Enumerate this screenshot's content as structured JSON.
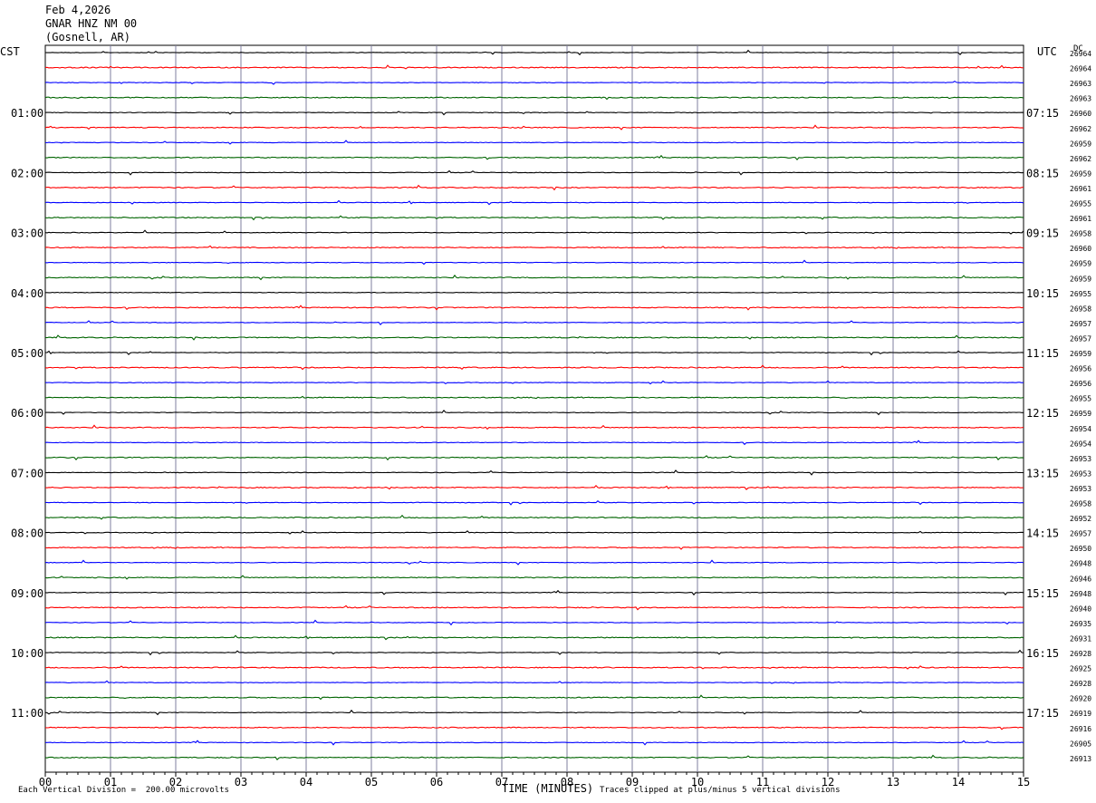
{
  "header": {
    "date": "Feb 4,2026",
    "station": "GNAR HNZ NM 00",
    "location": "(Gosnell, AR)"
  },
  "left_zone": "CST",
  "right_zone": "UTC",
  "dc_label": "DC",
  "footer": {
    "scale_text": "Each Vertical Division =  200.00 microvolts",
    "xlabel": "TIME (MINUTES)",
    "clip_text": "Traces clipped at plus/minus 5 vertical divisions"
  },
  "colors": {
    "trace_cycle": [
      "#000000",
      "#ff0000",
      "#0000ff",
      "#006400"
    ],
    "grid": "#7f7f9f"
  },
  "chart_data": {
    "type": "line",
    "title": "GNAR HNZ NM 00",
    "xlabel": "TIME (MINUTES)",
    "xlim": [
      0,
      15
    ],
    "x_ticks": [
      "00",
      "01",
      "02",
      "03",
      "04",
      "05",
      "06",
      "07",
      "08",
      "09",
      "10",
      "11",
      "12",
      "13",
      "14",
      "15"
    ],
    "left_hour_labels": [
      "01:00",
      "02:00",
      "03:00",
      "04:00",
      "05:00",
      "06:00",
      "07:00",
      "08:00",
      "09:00",
      "10:00",
      "11:00"
    ],
    "right_hour_labels": [
      "07:15",
      "08:15",
      "09:15",
      "10:15",
      "11:15",
      "12:15",
      "13:15",
      "14:15",
      "15:15",
      "16:15",
      "17:15"
    ],
    "dc_offsets": [
      "26964",
      "26964",
      "26963",
      "26963",
      "26960",
      "26962",
      "26959",
      "26962",
      "26959",
      "26961",
      "26955",
      "26961",
      "26958",
      "26960",
      "26959",
      "26959",
      "26955",
      "26958",
      "26957",
      "26957",
      "26959",
      "26956",
      "26956",
      "26955",
      "26959",
      "26954",
      "26954",
      "26953",
      "26953",
      "26953",
      "26958",
      "26952",
      "26957",
      "26950",
      "26948",
      "26946",
      "26948",
      "26940",
      "26935",
      "26931",
      "26928",
      "26925",
      "26928",
      "26920",
      "26919",
      "26916",
      "26905",
      "26913"
    ],
    "trace_count": 48,
    "minutes_per_trace": 15
  }
}
